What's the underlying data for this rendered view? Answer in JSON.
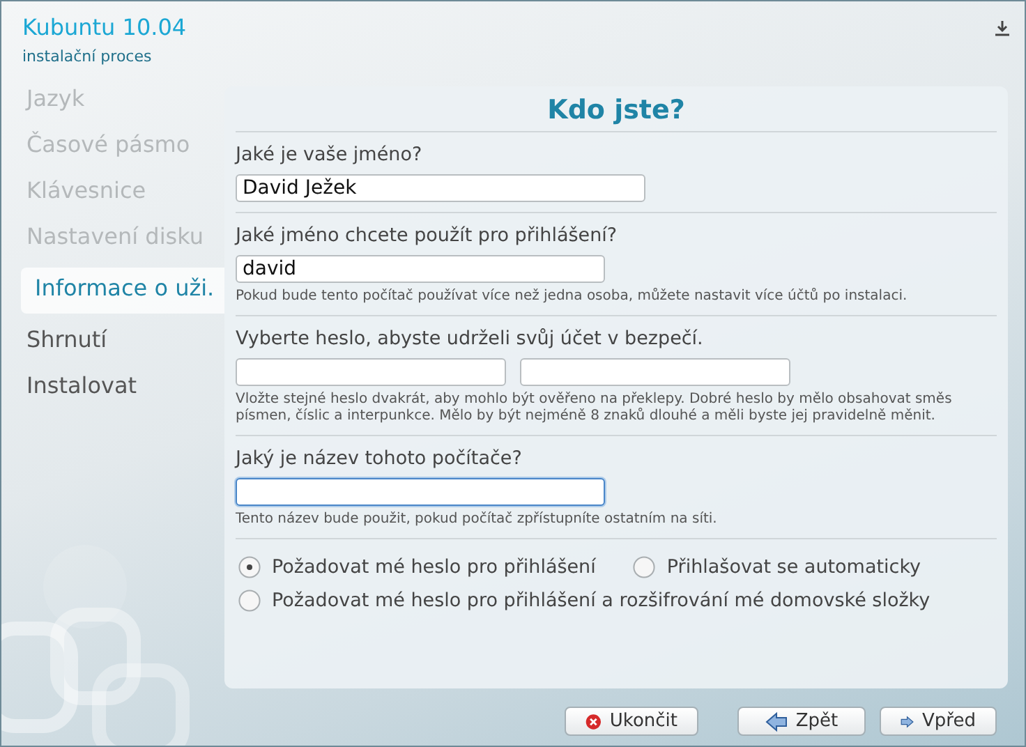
{
  "header": {
    "title": "Kubuntu 10.04",
    "subtitle": "instalační proces"
  },
  "sidebar": {
    "items": [
      {
        "label": "Jazyk",
        "disabled": true,
        "selected": false
      },
      {
        "label": "Časové pásmo",
        "disabled": true,
        "selected": false
      },
      {
        "label": "Klávesnice",
        "disabled": true,
        "selected": false
      },
      {
        "label": "Nastavení disku",
        "disabled": true,
        "selected": false
      },
      {
        "label": "Informace o uži.",
        "disabled": false,
        "selected": true
      },
      {
        "label": "Shrnutí",
        "disabled": false,
        "selected": false
      },
      {
        "label": "Instalovat",
        "disabled": false,
        "selected": false
      }
    ]
  },
  "panel": {
    "title": "Kdo jste?",
    "sections": [
      {
        "question": "Jaké je vaše jméno?",
        "fields": [
          {
            "value": "David Ježek",
            "focused": false
          }
        ]
      },
      {
        "question": "Jaké jméno chcete použít pro přihlášení?",
        "fields": [
          {
            "value": "david",
            "focused": false
          }
        ],
        "hint": "Pokud bude tento počítač používat více než jedna osoba, můžete nastavit více účtů po instalaci."
      },
      {
        "question": "Vyberte heslo, abyste udrželi svůj účet v bezpečí.",
        "fields": [
          {
            "focused": false
          },
          {
            "focused": false
          }
        ],
        "hint": "Vložte stejné heslo dvakrát, aby mohlo být ověřeno na překlepy. Dobré heslo by mělo obsahovat směs písmen, číslic a interpunkce. Mělo by být nejméně 8 znaků dlouhé a měli byste jej pravidelně měnit."
      },
      {
        "question": "Jaký je název tohoto počítače?",
        "fields": [
          {
            "focused": true
          }
        ],
        "hint": "Tento název bude použit, pokud počítač zpřístupníte ostatním na síti."
      }
    ],
    "login_options": [
      {
        "label": "Požadovat mé heslo pro přihlášení",
        "selected": true
      },
      {
        "label": "Přihlašovat se automaticky",
        "selected": false
      },
      {
        "label": "Požadovat mé heslo pro přihlášení a rozšifrování mé domovské složky",
        "selected": false
      }
    ]
  },
  "buttons": [
    {
      "kind": "quit",
      "label": "Ukončit"
    },
    {
      "kind": "back",
      "label": "Zpět"
    },
    {
      "kind": "forward",
      "label": "Vpřed"
    }
  ]
}
